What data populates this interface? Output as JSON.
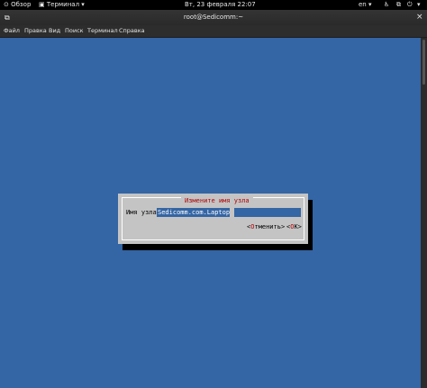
{
  "topbar": {
    "overview": "Обзор",
    "app": "Терминал",
    "clock": "Вт, 23 февраля  22:07",
    "lang": "en"
  },
  "window": {
    "title": "root@Sedicomm:~"
  },
  "menu": {
    "file": "Файл",
    "edit": "Правка",
    "view": "Вид",
    "search": "Поиск",
    "terminal": "Терминал",
    "help": "Справка"
  },
  "dialog": {
    "title": "Измените имя узла",
    "label": "Имя узла",
    "value": "Sedicomm.com.Laptop",
    "cancel_prefix": "<",
    "cancel_hotkey": "О",
    "cancel_rest": "тменить>",
    "ok_prefix": "<",
    "ok_hotkey": "O",
    "ok_rest": "K>"
  },
  "colors": {
    "terminal_bg": "#3465a4",
    "dialog_bg": "#c4c4c4",
    "hotkey": "#b00000"
  }
}
